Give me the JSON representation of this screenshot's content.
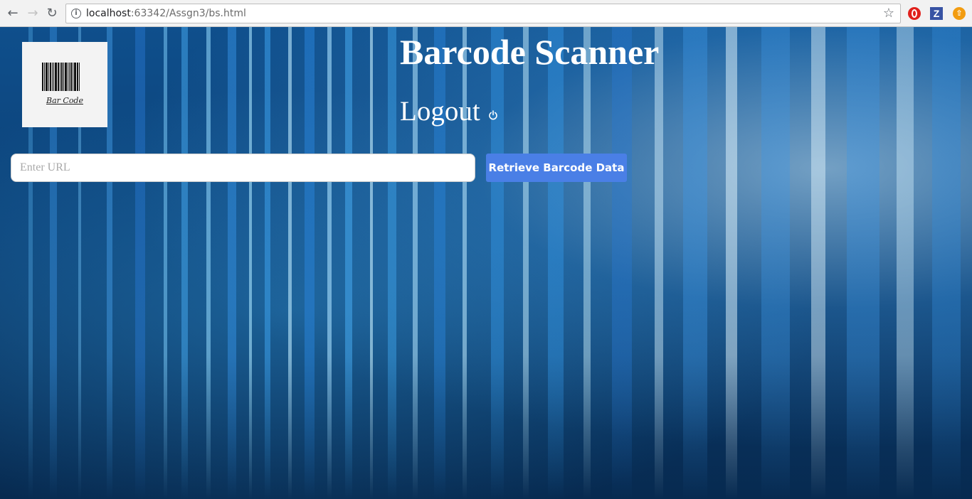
{
  "browser": {
    "url_host": "localhost",
    "url_rest": ":63342/Assgn3/bs.html"
  },
  "page": {
    "title": "Barcode Scanner",
    "logout_label": "Logout",
    "logo_caption": "Bar Code"
  },
  "search": {
    "placeholder": "Enter URL",
    "value": "",
    "button_label": "Retrieve Barcode Data"
  },
  "colors": {
    "button_bg": "#4a7fe6",
    "background": "#0b3f74"
  }
}
